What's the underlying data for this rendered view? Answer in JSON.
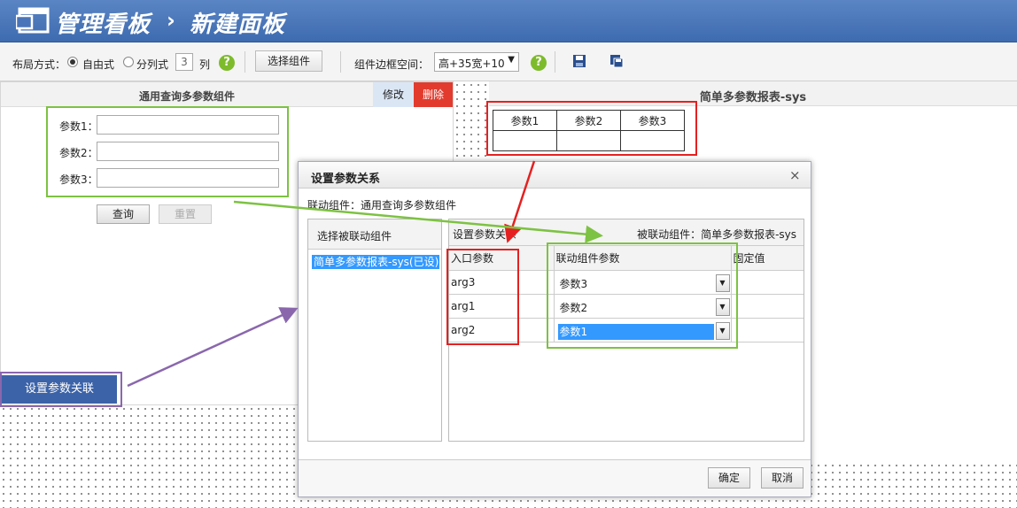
{
  "header": {
    "title": "管理看板",
    "separator": "›",
    "subtitle": "新建面板"
  },
  "toolbar": {
    "layout_label": "布局方式：",
    "free_label": "自由式",
    "column_label": "分列式",
    "column_count": "3",
    "column_unit": "列",
    "pick_button": "选择组件",
    "gap_label": "组件边框空间：",
    "gap_value": "高+35宽+10",
    "help": "?"
  },
  "left_panel": {
    "title": "通用查询多参数组件",
    "edit_label": "修改",
    "delete_label": "删除",
    "params": [
      {
        "label": "参数1："
      },
      {
        "label": "参数2："
      },
      {
        "label": "参数3："
      }
    ],
    "query_button": "查询",
    "reset_button": "重置"
  },
  "set_link_button": "设置参数关联",
  "right_panel": {
    "title": "简单多参数报表-sys",
    "columns": [
      "参数1",
      "参数2",
      "参数3"
    ]
  },
  "dialog": {
    "title": "设置参数关系",
    "close": "×",
    "linked_component": "联动组件：通用查询多参数组件",
    "left_title": "选择被联动组件",
    "left_item": "简单多参数报表-sys(已设)",
    "right_title": "设置参数关系",
    "right_target": "被联动组件：简单多参数报表-sys",
    "grid_headers": [
      "入口参数",
      "联动组件参数",
      "固定值"
    ],
    "rows": [
      {
        "entry": "arg3",
        "linked": "参数3",
        "fixed": ""
      },
      {
        "entry": "arg1",
        "linked": "参数2",
        "fixed": ""
      },
      {
        "entry": "arg2",
        "linked": "参数1",
        "fixed": ""
      }
    ],
    "ok_button": "确定",
    "cancel_button": "取消"
  },
  "colors": {
    "header_blue": "#4a74b9",
    "delete_red": "#e23b2e",
    "annotation_red": "#e52020",
    "annotation_green": "#7dc242",
    "annotation_purple": "#8a67ad",
    "selection_blue": "#3399ff"
  }
}
